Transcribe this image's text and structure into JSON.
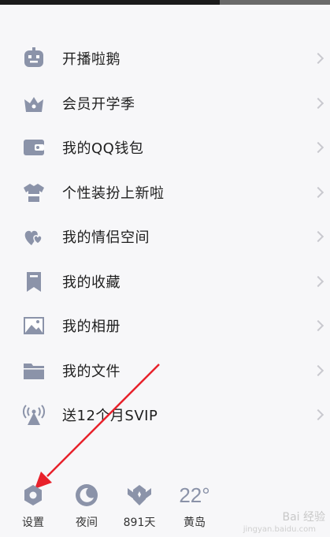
{
  "menu": {
    "items": [
      {
        "label": "开播啦鹅",
        "icon": "robot-icon"
      },
      {
        "label": "会员开学季",
        "icon": "crown-icon"
      },
      {
        "label": "我的QQ钱包",
        "icon": "wallet-icon"
      },
      {
        "label": "个性装扮上新啦",
        "icon": "shirt-icon"
      },
      {
        "label": "我的情侣空间",
        "icon": "hearts-icon"
      },
      {
        "label": "我的收藏",
        "icon": "bookmark-icon"
      },
      {
        "label": "我的相册",
        "icon": "photo-icon"
      },
      {
        "label": "我的文件",
        "icon": "folder-icon"
      },
      {
        "label": "送12个月SVIP",
        "icon": "broadcast-icon"
      }
    ]
  },
  "bottom": {
    "settings": "设置",
    "night": "夜间",
    "days": "891天",
    "weather_temp": "22°",
    "weather_city": "黄岛"
  },
  "watermark": {
    "text": "Bai 经验",
    "sub": "jingyan.baidu.com"
  },
  "colors": {
    "icon": "#8b93a9",
    "annotation": "#e8212b"
  }
}
